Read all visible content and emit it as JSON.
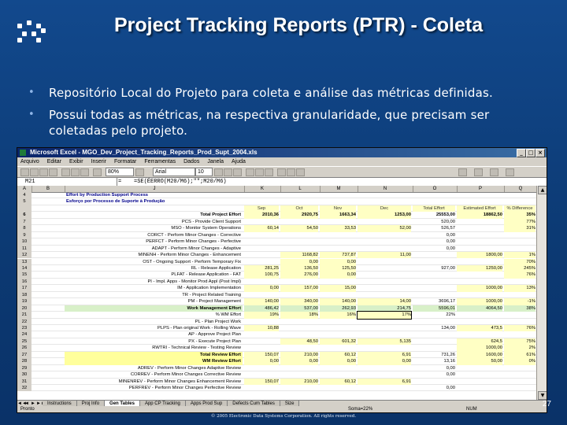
{
  "slide": {
    "title": "Project Tracking Reports (PTR) - Coleta",
    "bullets": [
      "Repositório Local do Projeto para coleta e análise das métricas definidas.",
      "Possui todas as métricas, na respectiva granularidade, que precisam ser coletadas pelo projeto."
    ],
    "footer": "© 2005 Electronic Data Systems Corporation. All rights reserved.",
    "page_number": "27"
  },
  "excel": {
    "window_title": "Microsoft Excel - MGO_Dev_Project_Tracking_Reports_Prod_Supt_2004.xls",
    "menu": [
      "Arquivo",
      "Editar",
      "Exibir",
      "Inserir",
      "Formatar",
      "Ferramentas",
      "Dados",
      "Janela",
      "Ajuda"
    ],
    "zoom": "80%",
    "font_name": "Arial",
    "font_size": "10",
    "name_box": "M21",
    "formula": "=SE(ÉERRO(M20/M6);\"\";M20/M6)",
    "columns": [
      "A",
      "B",
      "J",
      "K",
      "L",
      "M",
      "N",
      "O",
      "P",
      "Q"
    ],
    "heading": "Effort by Production Support Process",
    "heading_sub": "Esforço por Processo de Suporte à Produção",
    "col_headers": [
      "Sep",
      "Oct",
      "Nov",
      "Dec",
      "Total Effort",
      "Estimated Effort",
      "% Difference"
    ],
    "rows": [
      {
        "n": "6",
        "label": "Total Project Effort",
        "style": "ttl",
        "v": [
          "2010,36",
          "2920,75",
          "1663,34",
          "1253,00",
          "25553,00",
          "18862,50",
          "35%"
        ]
      },
      {
        "n": "7",
        "label": "PCS - Provide Client Support",
        "style": "",
        "v": [
          "",
          "",
          "",
          "",
          "520,00",
          "",
          "77%"
        ]
      },
      {
        "n": "8",
        "label": "MSO - Monitor System Operations",
        "style": "",
        "v": [
          "60,14",
          "54,50",
          "33,53",
          "52,00",
          "526,57",
          "",
          "31%"
        ]
      },
      {
        "n": "9",
        "label": "CORCT - Perform Minor Changes - Corrective",
        "style": "",
        "v": [
          "",
          "",
          "",
          "",
          "0,00",
          "",
          ""
        ]
      },
      {
        "n": "10",
        "label": "PERFCT - Perform Minor Changes - Perfective",
        "style": "",
        "v": [
          "",
          "",
          "",
          "",
          "0,00",
          "",
          ""
        ]
      },
      {
        "n": "11",
        "label": "ADAPT - Perform Minor Changes - Adaptive",
        "style": "",
        "v": [
          "",
          "",
          "",
          "",
          "0,00",
          "",
          ""
        ]
      },
      {
        "n": "12",
        "label": "MINENH - Perform Minor Changes - Enhancement",
        "style": "",
        "v": [
          "",
          "1168,82",
          "737,87",
          "11,00",
          "",
          "1800,00",
          "1%"
        ]
      },
      {
        "n": "13",
        "label": "OST - Ongoing Support - Perform Temporary Fix",
        "style": "",
        "v": [
          "",
          "0,00",
          "0,00",
          "",
          "",
          "",
          "70%"
        ]
      },
      {
        "n": "14",
        "label": "RL - Release Application",
        "style": "",
        "v": [
          "281,25",
          "136,50",
          "125,50",
          "",
          "927,00",
          "1250,00",
          "245%"
        ]
      },
      {
        "n": "15",
        "label": "PLFAT - Release Application - FAT",
        "style": "",
        "v": [
          "100,75",
          "276,00",
          "0,00",
          "",
          "",
          "",
          "76%"
        ]
      },
      {
        "n": "16",
        "label": "PI - Impl. Apps - Monitor Prod Appl (Post Impl)",
        "style": "",
        "v": [
          "",
          "",
          "",
          "",
          "",
          "",
          ""
        ]
      },
      {
        "n": "17",
        "label": "IM - Application Implementation",
        "style": "",
        "v": [
          "0,00",
          "157,00",
          "15,00",
          "",
          "",
          "1000,00",
          "13%"
        ]
      },
      {
        "n": "18",
        "label": "TR - Project Related Training",
        "style": "",
        "v": [
          "",
          "",
          "",
          "",
          "",
          "",
          ""
        ]
      },
      {
        "n": "19",
        "label": "PM - Project Management",
        "style": "",
        "v": [
          "140,00",
          "340,00",
          "140,00",
          "14,00",
          "3696,17",
          "1000,00",
          "-1%"
        ]
      },
      {
        "n": "20",
        "label": "Work Management Effort",
        "style": "green",
        "v": [
          "486,42",
          "537,00",
          "262,93",
          "214,75",
          "5596,01",
          "4064,50",
          "38%"
        ]
      },
      {
        "n": "21",
        "label": "% WM Effort",
        "style": "sel",
        "v": [
          "19%",
          "18%",
          "16%",
          "17%",
          "22%",
          "",
          ""
        ]
      },
      {
        "n": "22",
        "label": "PL - Plan Project Work",
        "style": "",
        "v": [
          "",
          "",
          "",
          "",
          "",
          "",
          ""
        ]
      },
      {
        "n": "23",
        "label": "PLPS - Plan original Work - Rolling Wave",
        "style": "",
        "v": [
          "10,88",
          "",
          "",
          "",
          "134,00",
          "473,5",
          "76%"
        ]
      },
      {
        "n": "24",
        "label": "AP - Approve Project Plan",
        "style": "",
        "v": [
          "",
          "",
          "",
          "",
          "",
          "",
          ""
        ]
      },
      {
        "n": "25",
        "label": "PX - Execute Project Plan",
        "style": "",
        "v": [
          "",
          "48,50",
          "601,32",
          "5,135",
          "",
          "624,5",
          "75%"
        ]
      },
      {
        "n": "26",
        "label": "RWTRI - Technical Review - Testing Review",
        "style": "",
        "v": [
          "",
          "",
          "",
          "",
          "",
          "1000,00",
          "2%"
        ]
      },
      {
        "n": "27",
        "label": "Total Review Effort",
        "style": "hl",
        "v": [
          "150,07",
          "210,00",
          "60,12",
          "6,91",
          "731,26",
          "1600,00",
          "61%"
        ]
      },
      {
        "n": "28",
        "label": "WM Review Effort",
        "style": "hl",
        "v": [
          "0,00",
          "0,00",
          "0,00",
          "0,00",
          "13,16",
          "50,00",
          "0%"
        ]
      },
      {
        "n": "29",
        "label": "ADREV - Perform Minor Changes Adaptive Review",
        "style": "",
        "v": [
          "",
          "",
          "",
          "",
          "0,00",
          "",
          ""
        ]
      },
      {
        "n": "30",
        "label": "CORREV - Perform Minor Changes Corrective Review",
        "style": "",
        "v": [
          "",
          "",
          "",
          "",
          "0,00",
          "",
          ""
        ]
      },
      {
        "n": "31",
        "label": "MINENREV - Perform Minor Changes Enhancement Review",
        "style": "",
        "v": [
          "150,07",
          "210,00",
          "60,12",
          "6,91",
          "",
          "",
          ""
        ]
      },
      {
        "n": "32",
        "label": "PERFREV - Perform Minor Changes Perfective Review",
        "style": "",
        "v": [
          "",
          "",
          "",
          "",
          "0,00",
          "",
          ""
        ]
      }
    ],
    "sheet_tabs": [
      "Instructions",
      "Proj Info",
      "Gen Tables",
      "App CP Tracking",
      "Apps Prod Sup",
      "Defects Cum Tables",
      "Size"
    ],
    "active_tab": "Gen Tables",
    "status_left": "Pronto",
    "status_mid": "Soma=22%",
    "status_right": "NUM"
  },
  "icons": {
    "logo": "eds-dot-logo-icon",
    "close": "close-icon",
    "min": "minimize-icon",
    "max": "maximize-icon"
  }
}
